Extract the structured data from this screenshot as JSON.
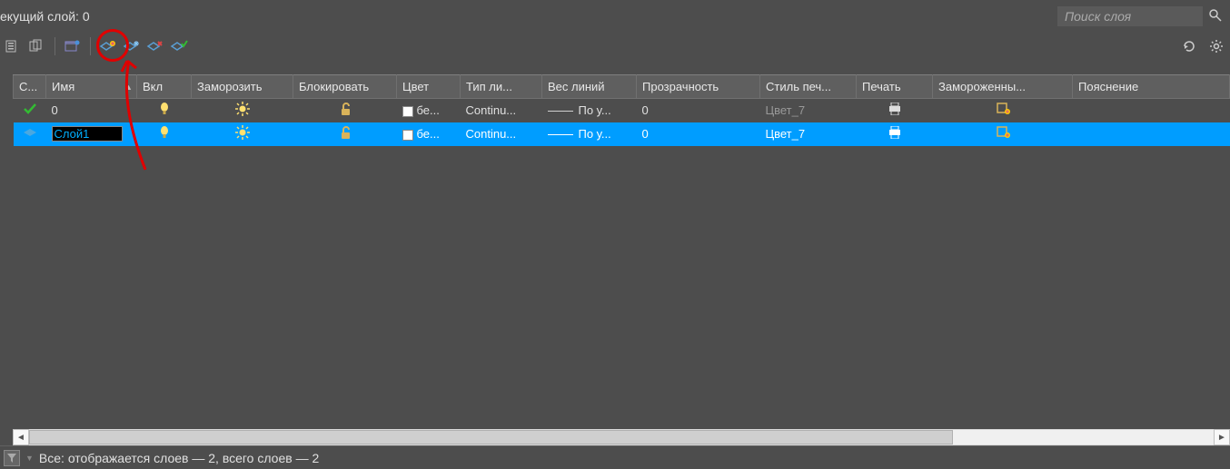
{
  "header": {
    "current_layer_label": "екущий слой: 0",
    "search_placeholder": "Поиск слоя"
  },
  "columns": {
    "status": "С...",
    "name": "Имя",
    "on": "Вкл",
    "freeze": "Заморозить",
    "lock": "Блокировать",
    "color": "Цвет",
    "linetype": "Тип ли...",
    "lineweight": "Вес линий",
    "transparency": "Прозрачность",
    "plotstyle": "Стиль печ...",
    "plot": "Печать",
    "vpfreeze": "Замороженны...",
    "description": "Пояснение"
  },
  "rows": [
    {
      "selected": false,
      "current": true,
      "name": "0",
      "editing": false,
      "color_label": "бе...",
      "linetype": "Continu...",
      "lineweight_label": "По у...",
      "transparency": "0",
      "plotstyle": "Цвет_7"
    },
    {
      "selected": true,
      "current": false,
      "name": "Слой1",
      "editing": true,
      "color_label": "бе...",
      "linetype": "Continu...",
      "lineweight_label": "По у...",
      "transparency": "0",
      "plotstyle": "Цвет_7"
    }
  ],
  "status": {
    "text": "Все: отображается слоев — 2, всего слоев — 2"
  }
}
